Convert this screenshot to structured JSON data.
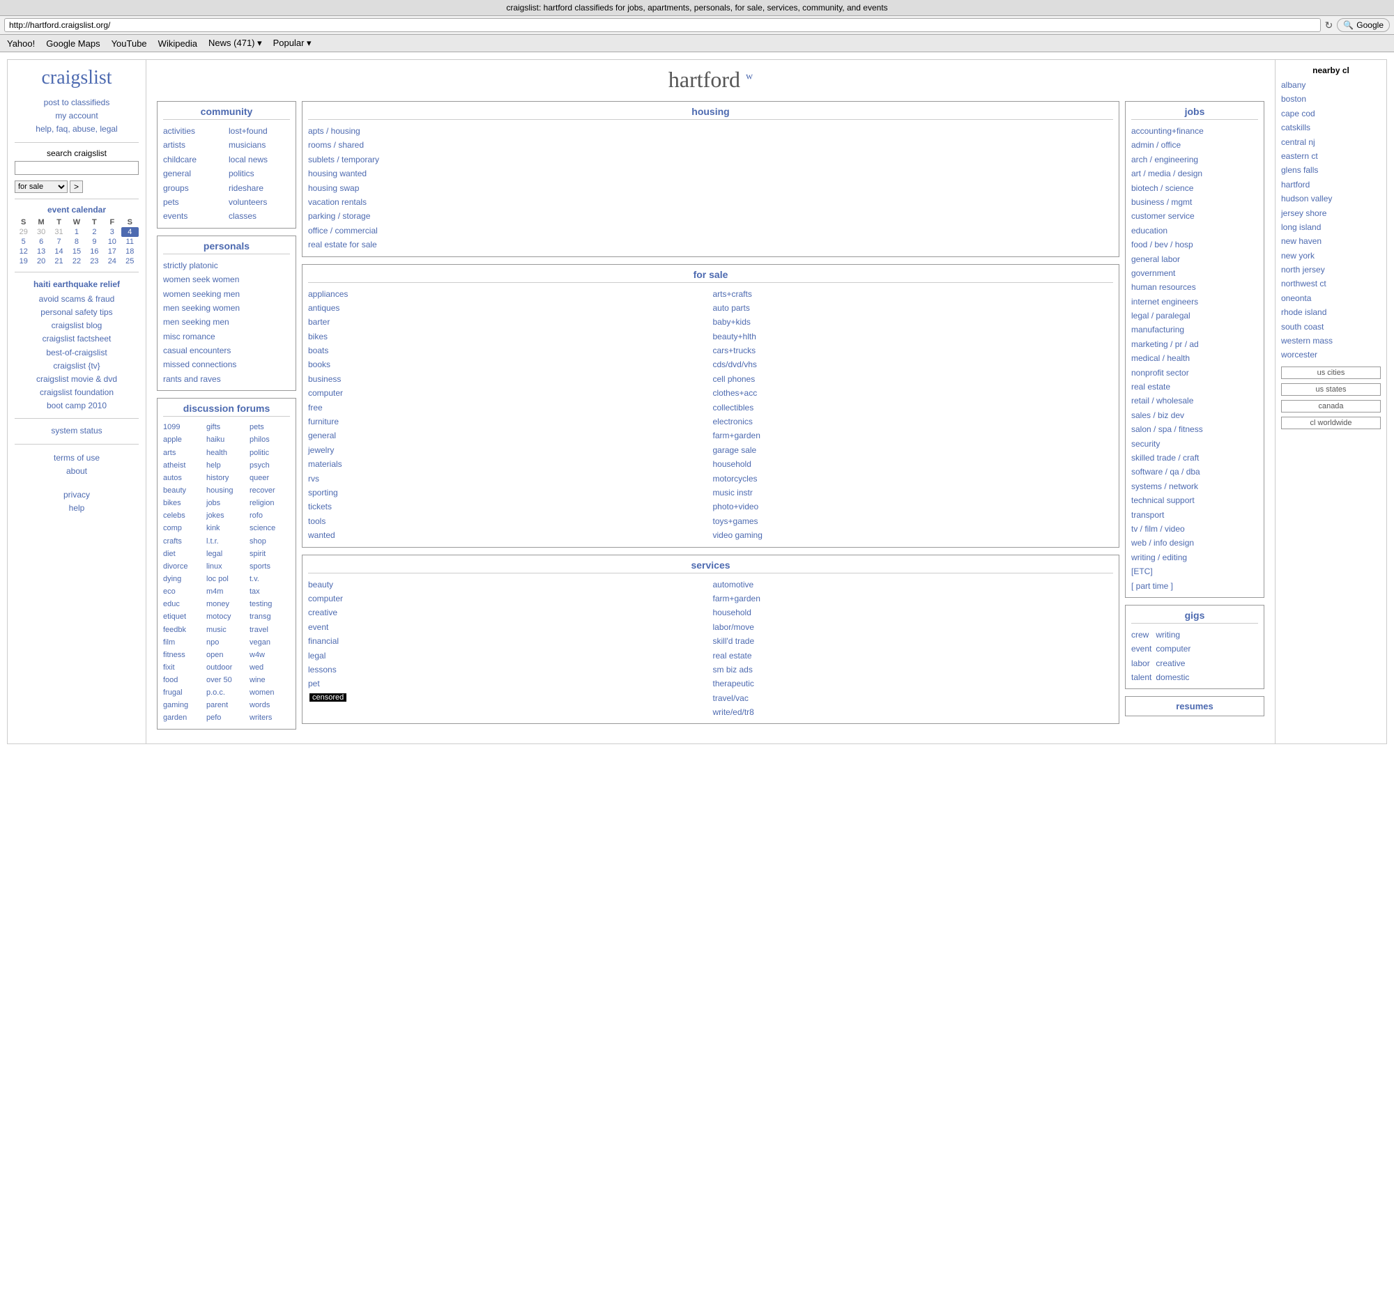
{
  "browser": {
    "title": "craigslist: hartford classifieds for jobs, apartments, personals, for sale, services, community, and events",
    "address": "http://hartford.craigslist.org/",
    "refresh_symbol": "↻",
    "search_placeholder": "Google",
    "nav_items": [
      {
        "label": "Yahoo!",
        "url": "#"
      },
      {
        "label": "Google Maps",
        "url": "#"
      },
      {
        "label": "YouTube",
        "url": "#"
      },
      {
        "label": "Wikipedia",
        "url": "#"
      },
      {
        "label": "News (471) ▾",
        "url": "#"
      },
      {
        "label": "Popular ▾",
        "url": "#"
      }
    ]
  },
  "sidebar": {
    "logo": "craigslist",
    "links": [
      {
        "label": "post to classifieds",
        "url": "#"
      },
      {
        "label": "my account",
        "url": "#"
      },
      {
        "label": "help, faq, abuse, legal",
        "url": "#"
      }
    ],
    "search_label": "search craigslist",
    "search_placeholder": "",
    "search_option": "for sale",
    "haiti_link": "haiti earthquake relief",
    "extra_links": [
      {
        "label": "avoid scams & fraud",
        "url": "#"
      },
      {
        "label": "personal safety tips",
        "url": "#"
      },
      {
        "label": "craigslist blog",
        "url": "#"
      },
      {
        "label": "craigslist factsheet",
        "url": "#"
      },
      {
        "label": "best-of-craigslist",
        "url": "#"
      },
      {
        "label": "craigslist {tv}",
        "url": "#"
      },
      {
        "label": "craigslist movie & dvd",
        "url": "#"
      },
      {
        "label": "craigslist foundation",
        "url": "#"
      },
      {
        "label": "boot camp 2010",
        "url": "#"
      }
    ],
    "system_status": {
      "label": "system status",
      "url": "#"
    },
    "footer_links": [
      {
        "label": "terms of use",
        "url": "#"
      },
      {
        "label": "about",
        "url": "#"
      },
      {
        "label": "privacy",
        "url": "#"
      },
      {
        "label": "help",
        "url": "#"
      }
    ],
    "calendar": {
      "title": "event calendar",
      "days": [
        "S",
        "M",
        "T",
        "W",
        "T",
        "F",
        "S"
      ],
      "weeks": [
        [
          {
            "num": "29",
            "gray": true
          },
          {
            "num": "30",
            "gray": true
          },
          {
            "num": "31",
            "gray": true
          },
          {
            "num": "1",
            "gray": false
          },
          {
            "num": "2",
            "gray": false
          },
          {
            "num": "3",
            "gray": false
          },
          {
            "num": "4",
            "today": true
          }
        ],
        [
          {
            "num": "5"
          },
          {
            "num": "6"
          },
          {
            "num": "7"
          },
          {
            "num": "8"
          },
          {
            "num": "9"
          },
          {
            "num": "10"
          },
          {
            "num": "11"
          }
        ],
        [
          {
            "num": "12"
          },
          {
            "num": "13"
          },
          {
            "num": "14"
          },
          {
            "num": "15"
          },
          {
            "num": "16"
          },
          {
            "num": "17"
          },
          {
            "num": "18"
          }
        ],
        [
          {
            "num": "19"
          },
          {
            "num": "20"
          },
          {
            "num": "21"
          },
          {
            "num": "22"
          },
          {
            "num": "23"
          },
          {
            "num": "24"
          },
          {
            "num": "25"
          }
        ]
      ]
    }
  },
  "main": {
    "city": "hartford",
    "city_sup": "w",
    "community": {
      "title": "community",
      "col1": [
        "activities",
        "artists",
        "childcare",
        "general",
        "groups",
        "pets",
        "events"
      ],
      "col2": [
        "lost+found",
        "musicians",
        "local news",
        "politics",
        "rideshare",
        "volunteers",
        "classes"
      ]
    },
    "personals": {
      "title": "personals",
      "links": [
        "strictly platonic",
        "women seek women",
        "women seeking men",
        "men seeking women",
        "men seeking men",
        "misc romance",
        "casual encounters",
        "missed connections",
        "rants and raves"
      ]
    },
    "forums": {
      "title": "discussion forums",
      "col1": [
        "1099",
        "apple",
        "arts",
        "atheist",
        "autos",
        "beauty",
        "bikes",
        "celebs",
        "comp",
        "crafts",
        "diet",
        "divorce",
        "dying",
        "eco",
        "educ",
        "etiquet",
        "feedbk",
        "film",
        "fitness",
        "fixit",
        "food",
        "frugal",
        "gaming",
        "garden"
      ],
      "col2": [
        "gifts",
        "haiku",
        "health",
        "help",
        "history",
        "housing",
        "jobs",
        "jokes",
        "kink",
        "l.t.r.",
        "legal",
        "linux",
        "loc pol",
        "m4m",
        "money",
        "motocy",
        "music",
        "npo",
        "open",
        "outdoor",
        "over 50",
        "p.o.c.",
        "parent",
        "pefo"
      ],
      "col3": [
        "pets",
        "philos",
        "politic",
        "psych",
        "queer",
        "recover",
        "religion",
        "rofo",
        "science",
        "shop",
        "spirit",
        "sports",
        "t.v.",
        "tax",
        "testing",
        "transg",
        "travel",
        "vegan",
        "w4w",
        "wed",
        "wine",
        "women",
        "words",
        "writers"
      ]
    },
    "housing": {
      "title": "housing",
      "links": [
        "apts / housing",
        "rooms / shared",
        "sublets / temporary",
        "housing wanted",
        "housing swap",
        "vacation rentals",
        "parking / storage",
        "office / commercial",
        "real estate for sale"
      ]
    },
    "for_sale": {
      "title": "for sale",
      "col1": [
        "appliances",
        "antiques",
        "barter",
        "bikes",
        "boats",
        "books",
        "business",
        "computer",
        "free",
        "furniture",
        "general",
        "jewelry",
        "materials",
        "rvs",
        "sporting",
        "tickets",
        "tools",
        "wanted"
      ],
      "col2": [
        "arts+crafts",
        "auto parts",
        "baby+kids",
        "beauty+hlth",
        "cars+trucks",
        "cds/dvd/vhs",
        "cell phones",
        "clothes+acc",
        "collectibles",
        "electronics",
        "farm+garden",
        "garage sale",
        "household",
        "motorcycles",
        "music instr",
        "photo+video",
        "toys+games",
        "video gaming"
      ]
    },
    "services": {
      "title": "services",
      "col1": [
        "beauty",
        "computer",
        "creative",
        "event",
        "financial",
        "legal",
        "lessons",
        "pet"
      ],
      "col2": [
        "automotive",
        "farm+garden",
        "household",
        "labor/move",
        "skill'd trade",
        "real estate",
        "sm biz ads",
        "therapeutic",
        "travel/vac",
        "write/ed/tr8"
      ]
    },
    "jobs": {
      "title": "jobs",
      "links": [
        "accounting+finance",
        "admin / office",
        "arch / engineering",
        "art / media / design",
        "biotech / science",
        "business / mgmt",
        "customer service",
        "education",
        "food / bev / hosp",
        "general labor",
        "government",
        "human resources",
        "internet engineers",
        "legal / paralegal",
        "manufacturing",
        "marketing / pr / ad",
        "medical / health",
        "nonprofit sector",
        "real estate",
        "retail / wholesale",
        "sales / biz dev",
        "salon / spa / fitness",
        "security",
        "skilled trade / craft",
        "software / qa / dba",
        "systems / network",
        "technical support",
        "transport",
        "tv / film / video",
        "web / info design",
        "writing / editing",
        "[ETC]",
        "[ part time ]"
      ]
    },
    "gigs": {
      "title": "gigs",
      "col1": [
        "crew",
        "event",
        "labor",
        "talent"
      ],
      "col2": [
        "writing",
        "computer",
        "creative",
        "domestic"
      ]
    },
    "resumes": "resumes"
  },
  "nearby": {
    "title": "nearby cl",
    "cities": [
      "albany",
      "boston",
      "cape cod",
      "catskills",
      "central nj",
      "eastern ct",
      "glens falls",
      "hartford",
      "hudson valley",
      "jersey shore",
      "long island",
      "new haven",
      "new york",
      "north jersey",
      "northwest ct",
      "oneonta",
      "rhode island",
      "south coast",
      "western mass",
      "worcester"
    ],
    "sections": [
      {
        "label": "us cities"
      },
      {
        "label": "us states"
      },
      {
        "label": "canada"
      },
      {
        "label": "cl worldwide"
      }
    ]
  }
}
